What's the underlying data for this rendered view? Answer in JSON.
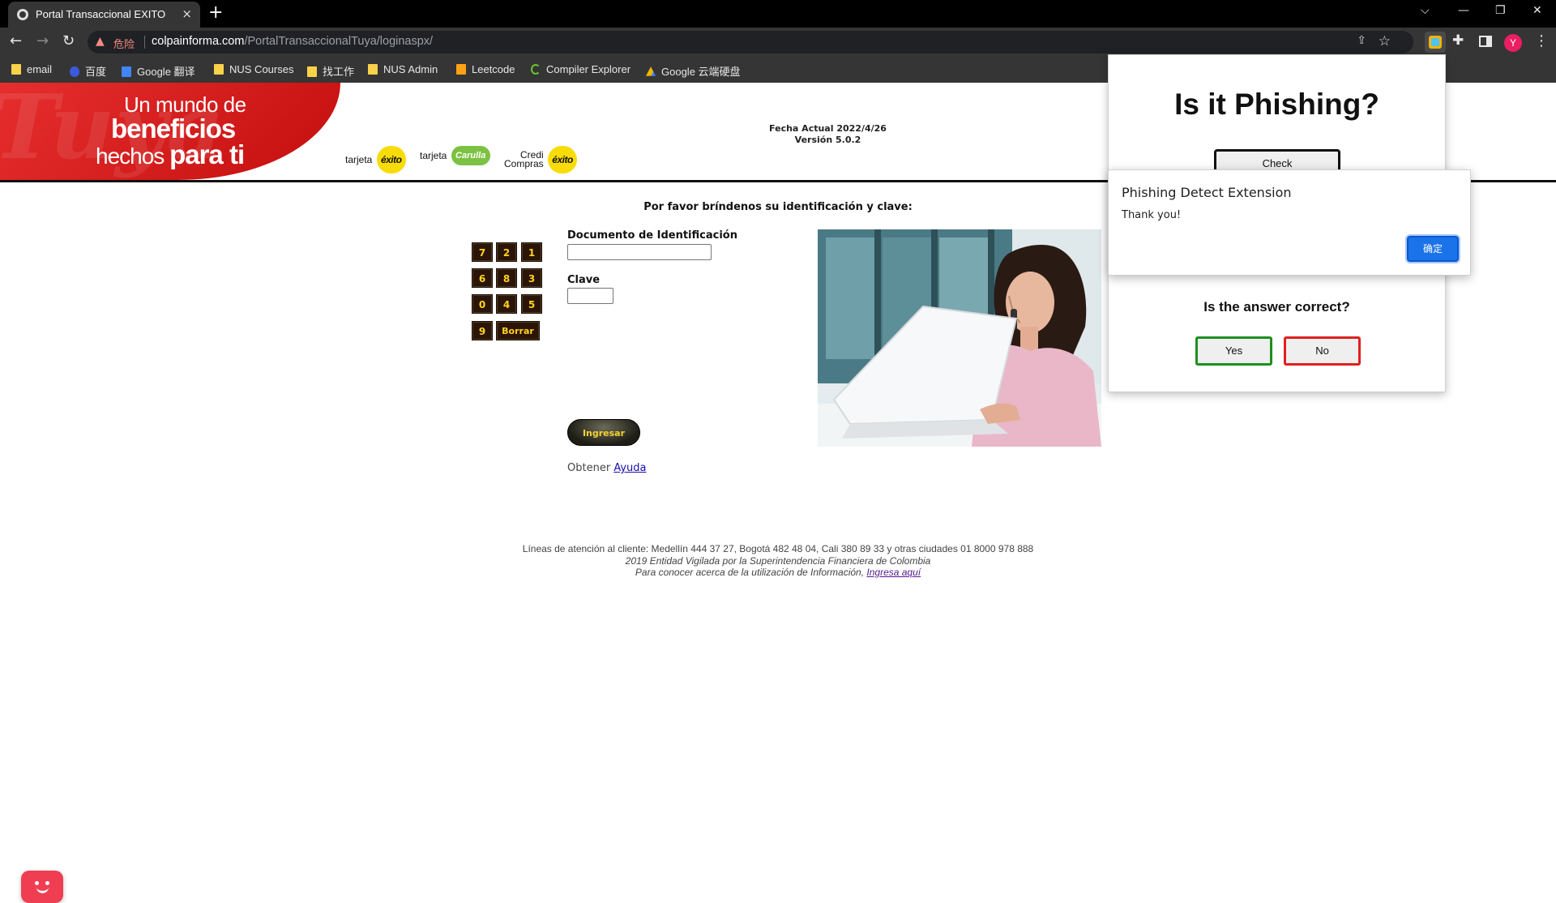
{
  "browser": {
    "tab_title": "Portal Transaccional EXITO",
    "tab_close": "×",
    "new_tab": "+",
    "window_controls": [
      "⌵",
      "—",
      "❐",
      "✕"
    ],
    "security_label": "危险",
    "url_host": "colpainforma.com",
    "url_path": "/PortalTransaccionalTuya/loginaspx/",
    "profile_initial": "Y",
    "bookmarks": [
      {
        "label": "email",
        "icon": "folder-icon"
      },
      {
        "label": "百度",
        "icon": "baidu-icon"
      },
      {
        "label": "Google 翻译",
        "icon": "google-translate-icon"
      },
      {
        "label": "NUS Courses",
        "icon": "folder-icon"
      },
      {
        "label": "找工作",
        "icon": "folder-icon"
      },
      {
        "label": "NUS Admin",
        "icon": "folder-icon"
      },
      {
        "label": "Leetcode",
        "icon": "leetcode-icon"
      },
      {
        "label": "Compiler Explorer",
        "icon": "compiler-explorer-icon"
      },
      {
        "label": "Google 云端硬盘",
        "icon": "google-drive-icon"
      }
    ]
  },
  "banner": {
    "slogan_1": "Un mundo de",
    "slogan_2": "beneficios",
    "slogan_3a": "hechos",
    "slogan_3b": "para ti",
    "watermark": "Tuya",
    "cards": [
      {
        "label": "tarjeta",
        "brand": "éxito"
      },
      {
        "label": "tarjeta",
        "brand": "Carulla"
      },
      {
        "label_1": "Credi",
        "label_2": "Compras",
        "brand": "éxito"
      }
    ],
    "fecha": "Fecha Actual 2022/4/26",
    "version": "Versión 5.0.2"
  },
  "login": {
    "prompt": "Por favor bríndenos su identificación y clave:",
    "keypad": [
      "7",
      "2",
      "1",
      "6",
      "8",
      "3",
      "0",
      "4",
      "5",
      "9"
    ],
    "keypad_clear": "Borrar",
    "doc_label": "Documento de Identificación",
    "doc_value": "",
    "clave_label": "Clave",
    "clave_value": "",
    "submit": "Ingresar",
    "help_prefix": "Obtener",
    "help_link": "Ayuda"
  },
  "footer": {
    "line1": "Líneas de atención al cliente: Medellín 444 37 27, Bogotá 482 48 04, Cali 380 89 33 y otras ciudades 01 8000 978 888",
    "line2": "2019 Entidad Vigilada por la Superintendencia Financiera de Colombia",
    "line3_prefix": "Para conocer acerca de la utilización de Información,",
    "line3_link": "Ingresa aquí"
  },
  "extension_popup": {
    "title": "Is it Phishing?",
    "check_button": "Check",
    "correct_question": "Is the answer correct?",
    "yes": "Yes",
    "no": "No"
  },
  "alert": {
    "title": "Phishing Detect Extension",
    "message": "Thank you!",
    "ok": "确定"
  },
  "colors": {
    "brand_red": "#e62e2e",
    "brand_yellow": "#f7dc08",
    "keypad_gold": "#ffd21f",
    "yes_green": "#1e8f1e",
    "no_red": "#e02020",
    "ok_blue": "#1a73e8"
  }
}
